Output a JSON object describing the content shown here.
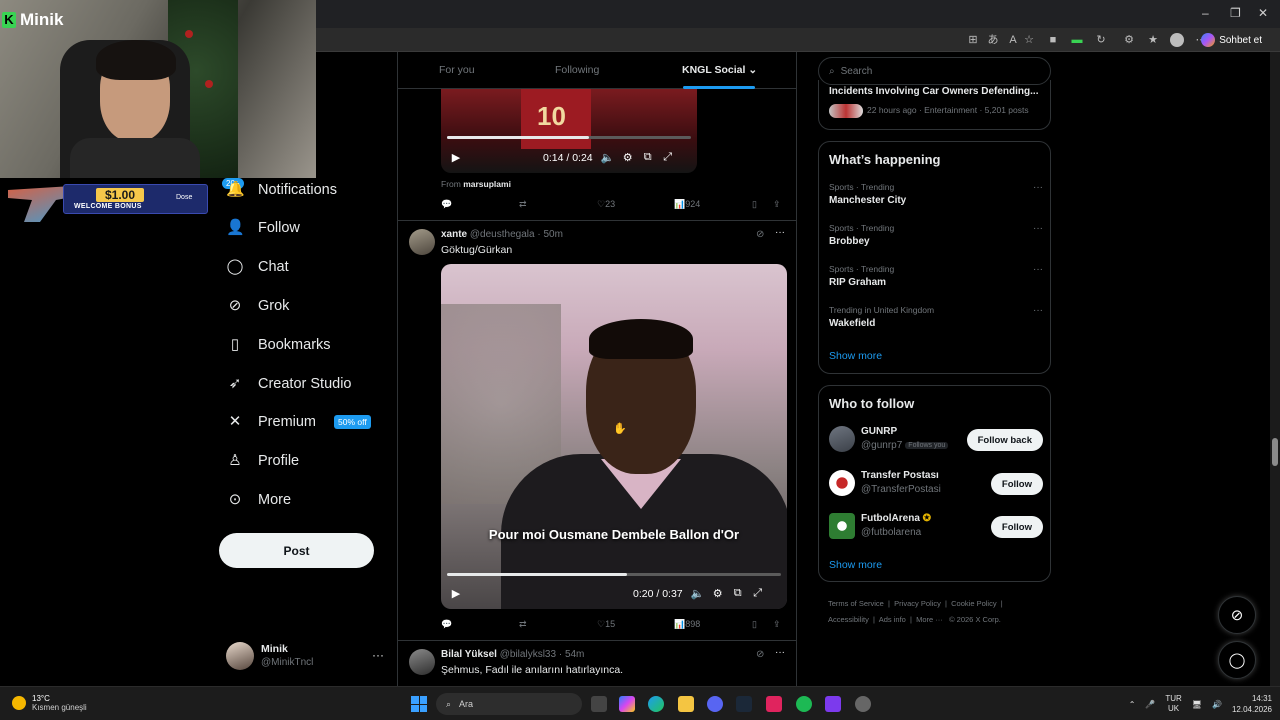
{
  "overlay": {
    "brand": "Minik",
    "bonus_amount": "$1.00",
    "bonus_text": "WELCOME BONUS",
    "bonus_brand": "Dose"
  },
  "browser": {
    "chat_label": "Sohbet et",
    "min": "–",
    "max": "❐",
    "close": "✕"
  },
  "nav": {
    "notif_badge": "20+",
    "items": [
      {
        "label": "Notifications",
        "icon": "bell-icon"
      },
      {
        "label": "Follow",
        "icon": "person-plus-icon"
      },
      {
        "label": "Chat",
        "icon": "chat-bubble-icon"
      },
      {
        "label": "Grok",
        "icon": "grok-icon"
      },
      {
        "label": "Bookmarks",
        "icon": "bookmark-icon"
      },
      {
        "label": "Creator Studio",
        "icon": "rocket-icon"
      },
      {
        "label": "Premium",
        "icon": "x-logo-icon"
      },
      {
        "label": "Profile",
        "icon": "person-icon"
      },
      {
        "label": "More",
        "icon": "more-circle-icon"
      }
    ],
    "premium_badge": "50% off",
    "post_label": "Post",
    "account": {
      "name": "Minik",
      "handle": "@MinikTncl"
    }
  },
  "tabs": [
    {
      "label": "For you"
    },
    {
      "label": "Following"
    },
    {
      "label": "KNGL Social"
    }
  ],
  "tweet1": {
    "video_time": "0:14 / 0:24",
    "video_progress": 0.58,
    "from_prefix": "From",
    "from_user": "marsuplami",
    "likes": "23",
    "views": "924"
  },
  "tweet2": {
    "name": "xante",
    "handle": "@deusthegala",
    "time": "50m",
    "text": "Göktug/Gürkan",
    "subtitle": "Pour moi Ousmane Dembele Ballon d'Or",
    "video_time": "0:20 / 0:37",
    "video_progress": 0.54,
    "likes": "15",
    "views": "898"
  },
  "tweet3": {
    "name": "Bilal Yüksel",
    "handle": "@bilalyksl33",
    "time": "54m",
    "text": "Şehmus, Fadıl ile anılarını hatırlayınca."
  },
  "right": {
    "search_placeholder": "Search",
    "top_news": {
      "title": "Incidents Involving Car Owners Defending...",
      "meta": "22 hours ago · Entertainment · 5,201 posts"
    },
    "happening_title": "What’s happening",
    "trends": [
      {
        "context": "Sports · Trending",
        "name": "Manchester City"
      },
      {
        "context": "Sports · Trending",
        "name": "Brobbey"
      },
      {
        "context": "Sports · Trending",
        "name": "RIP Graham"
      },
      {
        "context": "Trending in United Kingdom",
        "name": "Wakefield"
      }
    ],
    "show_more": "Show more",
    "wtf_title": "Who to follow",
    "who_to_follow": [
      {
        "name": "GUNRP",
        "handle": "@gunrp7",
        "follows_you": "Follows you",
        "button": "Follow back"
      },
      {
        "name": "Transfer Postası",
        "handle": "@TransferPostasi",
        "button": "Follow"
      },
      {
        "name": "FutbolArena",
        "handle": "@futbolarena",
        "button": "Follow"
      }
    ],
    "footer": {
      "links": [
        "Terms of Service",
        "Privacy Policy",
        "Cookie Policy",
        "Accessibility",
        "Ads info",
        "More ···"
      ],
      "copyright": "© 2026 X Corp."
    }
  },
  "taskbar": {
    "temp": "13°C",
    "weather": "Kısmen güneşli",
    "search": "Ara",
    "lang_top": "TUR",
    "lang_bottom": "UK",
    "time": "14:31",
    "date": "12.04.2026"
  }
}
